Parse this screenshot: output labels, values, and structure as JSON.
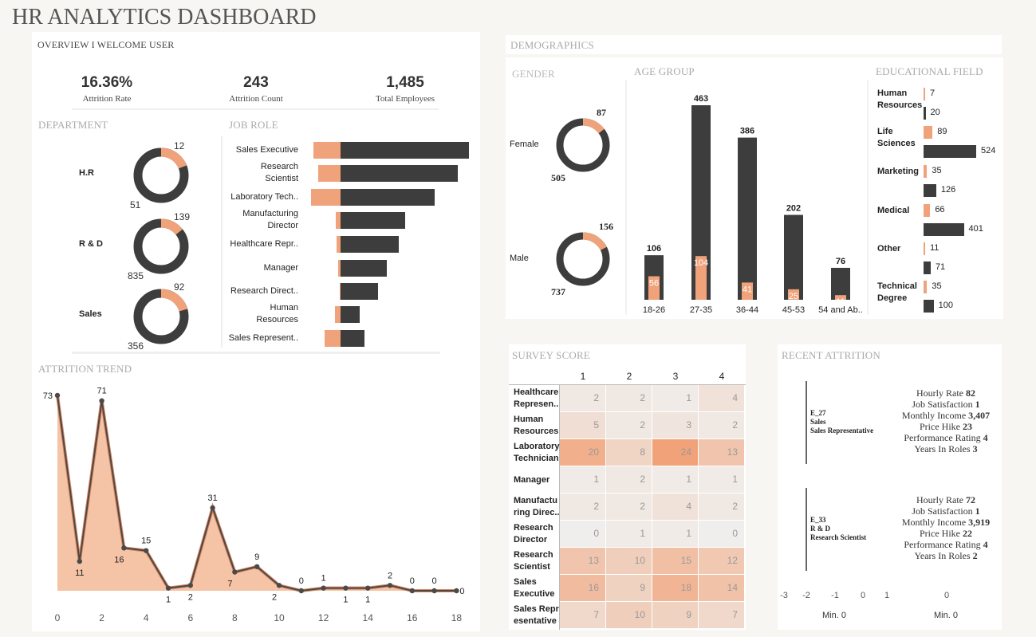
{
  "title": "HR ANALYTICS DASHBOARD",
  "colors": {
    "dark": "#3d3d3d",
    "accent": "#f0a27a",
    "accent_fill": "#f5c3a6"
  },
  "overview": {
    "title": "OVERVIEW I WELCOME USER",
    "kpis": [
      {
        "value": "16.36%",
        "label": "Attrition Rate"
      },
      {
        "value": "243",
        "label": "Attrition Count"
      },
      {
        "value": "1,485",
        "label": "Total Employees"
      }
    ]
  },
  "department": {
    "title": "DEPARTMENT",
    "items": [
      {
        "name": "H.R",
        "attrition": 12,
        "active": 51,
        "attrition_label": "12",
        "active_label": "51"
      },
      {
        "name": "R & D",
        "attrition": 139,
        "active": 835,
        "attrition_label": "139",
        "active_label": "835"
      },
      {
        "name": "Sales",
        "attrition": 92,
        "active": 356,
        "attrition_label": "92",
        "active_label": "356"
      }
    ]
  },
  "job_role": {
    "title": "JOB ROLE",
    "items": [
      {
        "label": "Sales Executive",
        "attrition": 57,
        "active": 269
      },
      {
        "label": "Research\nScientist",
        "attrition": 47,
        "active": 245
      },
      {
        "label": "Laboratory Tech..",
        "attrition": 62,
        "active": 197
      },
      {
        "label": "Manufacturing\nDirector",
        "attrition": 10,
        "active": 135
      },
      {
        "label": "Healthcare Repr..",
        "attrition": 9,
        "active": 122
      },
      {
        "label": "Manager",
        "attrition": 5,
        "active": 97
      },
      {
        "label": "Research Direct..",
        "attrition": 2,
        "active": 78
      },
      {
        "label": "Human\nResources",
        "attrition": 12,
        "active": 40
      },
      {
        "label": "Sales Represent..",
        "attrition": 33,
        "active": 50
      }
    ]
  },
  "attrition_trend": {
    "title": "ATTRITION TREND",
    "x_ticks": [
      "0",
      "2",
      "4",
      "6",
      "8",
      "10",
      "12",
      "14",
      "16",
      "18"
    ],
    "points": [
      {
        "x": 0,
        "y": 73,
        "label": "73",
        "pos": "left"
      },
      {
        "x": 1,
        "y": 11,
        "label": "11",
        "pos": "below"
      },
      {
        "x": 2,
        "y": 71,
        "label": "71",
        "pos": "above"
      },
      {
        "x": 3,
        "y": 16,
        "label": "16",
        "pos": "belowleft"
      },
      {
        "x": 4,
        "y": 15,
        "label": "15",
        "pos": "above"
      },
      {
        "x": 5,
        "y": 1,
        "label": "1",
        "pos": "below"
      },
      {
        "x": 6,
        "y": 2,
        "label": "2",
        "pos": "below"
      },
      {
        "x": 7,
        "y": 31,
        "label": "31",
        "pos": "above"
      },
      {
        "x": 8,
        "y": 7,
        "label": "7",
        "pos": "belowleft"
      },
      {
        "x": 9,
        "y": 9,
        "label": "9",
        "pos": "above"
      },
      {
        "x": 10,
        "y": 2,
        "label": "2",
        "pos": "belowleft"
      },
      {
        "x": 11,
        "y": 0,
        "label": "0",
        "pos": "above"
      },
      {
        "x": 12,
        "y": 1,
        "label": "1",
        "pos": "above"
      },
      {
        "x": 13,
        "y": 1,
        "label": "1",
        "pos": "below"
      },
      {
        "x": 14,
        "y": 1,
        "label": "1",
        "pos": "below"
      },
      {
        "x": 15,
        "y": 2,
        "label": "2",
        "pos": "above"
      },
      {
        "x": 16,
        "y": 0,
        "label": "0",
        "pos": "above"
      },
      {
        "x": 17,
        "y": 0,
        "label": "0",
        "pos": "above"
      },
      {
        "x": 18,
        "y": 0,
        "label": "0",
        "pos": "right"
      }
    ]
  },
  "demographics": {
    "title": "DEMOGRAPHICS",
    "gender": {
      "title": "GENDER",
      "items": [
        {
          "name": "Female",
          "attrition": 87,
          "active": 505,
          "attrition_label": "87",
          "active_label": "505"
        },
        {
          "name": "Male",
          "attrition": 156,
          "active": 737,
          "attrition_label": "156",
          "active_label": "737"
        }
      ]
    },
    "age_group": {
      "title": "AGE GROUP",
      "items": [
        {
          "label": "18-26",
          "total": 106,
          "attrition": 56,
          "total_label": "106",
          "attrition_label": "56"
        },
        {
          "label": "27-35",
          "total": 463,
          "attrition": 104,
          "total_label": "463",
          "attrition_label": "104"
        },
        {
          "label": "36-44",
          "total": 386,
          "attrition": 41,
          "total_label": "386",
          "attrition_label": "41"
        },
        {
          "label": "45-53",
          "total": 202,
          "attrition": 25,
          "total_label": "202",
          "attrition_label": "25"
        },
        {
          "label": "54 and Ab..",
          "total": 76,
          "attrition": 11,
          "total_label": "76",
          "attrition_label": "11"
        }
      ]
    },
    "education": {
      "title": "EDUCATIONAL FIELD",
      "items": [
        {
          "label": "Human\nResources",
          "attrition": 7,
          "active": 20,
          "attrition_label": "7",
          "active_label": "20"
        },
        {
          "label": "Life\nSciences",
          "attrition": 89,
          "active": 524,
          "attrition_label": "89",
          "active_label": "524"
        },
        {
          "label": "Marketing",
          "attrition": 35,
          "active": 126,
          "attrition_label": "35",
          "active_label": "126"
        },
        {
          "label": "Medical",
          "attrition": 66,
          "active": 401,
          "attrition_label": "66",
          "active_label": "401"
        },
        {
          "label": "Other",
          "attrition": 11,
          "active": 71,
          "attrition_label": "11",
          "active_label": "71"
        },
        {
          "label": "Technical\nDegree",
          "attrition": 35,
          "active": 100,
          "attrition_label": "35",
          "active_label": "100"
        }
      ]
    }
  },
  "survey": {
    "title": "SURVEY SCORE",
    "columns": [
      "1",
      "2",
      "3",
      "4"
    ],
    "rows": [
      {
        "label": "Healthcare\nRepresen..",
        "values": [
          2,
          2,
          1,
          4
        ]
      },
      {
        "label": "Human\nResources",
        "values": [
          5,
          2,
          3,
          2
        ]
      },
      {
        "label": "Laboratory\nTechnician",
        "values": [
          20,
          8,
          24,
          13
        ]
      },
      {
        "label": "Manager",
        "values": [
          1,
          2,
          1,
          1
        ]
      },
      {
        "label": "Manufactu\nring Direc..",
        "values": [
          2,
          2,
          4,
          2
        ]
      },
      {
        "label": "Research\nDirector",
        "values": [
          0,
          1,
          1,
          0
        ]
      },
      {
        "label": "Research\nScientist",
        "values": [
          13,
          10,
          15,
          12
        ]
      },
      {
        "label": "Sales\nExecutive",
        "values": [
          16,
          9,
          18,
          14
        ]
      },
      {
        "label": "Sales Repr\nesentative",
        "values": [
          7,
          10,
          9,
          7
        ]
      }
    ]
  },
  "recent_attrition": {
    "title": "RECENT ATTRITION",
    "records": [
      {
        "id": "E_27",
        "dept": "Sales",
        "role": "Sales Representative",
        "fields": [
          {
            "k": "Hourly Rate",
            "v": "82"
          },
          {
            "k": "Job Satisfaction",
            "v": "1"
          },
          {
            "k": "Monthly Income",
            "v": "3,407"
          },
          {
            "k": "Price Hike",
            "v": "23"
          },
          {
            "k": "Performance Rating",
            "v": "4"
          },
          {
            "k": "Years In Roles",
            "v": "3"
          }
        ]
      },
      {
        "id": "E_33",
        "dept": "R & D",
        "role": "Research Scientist",
        "fields": [
          {
            "k": "Hourly Rate",
            "v": "72"
          },
          {
            "k": "Job Satisfaction",
            "v": "1"
          },
          {
            "k": "Monthly Income",
            "v": "3,919"
          },
          {
            "k": "Price Hike",
            "v": "22"
          },
          {
            "k": "Performance Rating",
            "v": "4"
          },
          {
            "k": "Years In Roles",
            "v": "2"
          }
        ]
      }
    ],
    "axis_ticks": [
      "-3",
      "-2",
      "-1",
      "0",
      "1"
    ],
    "axis_tick_right": "0",
    "footer_left": "Min. 0",
    "footer_right": "Min. 0"
  }
}
